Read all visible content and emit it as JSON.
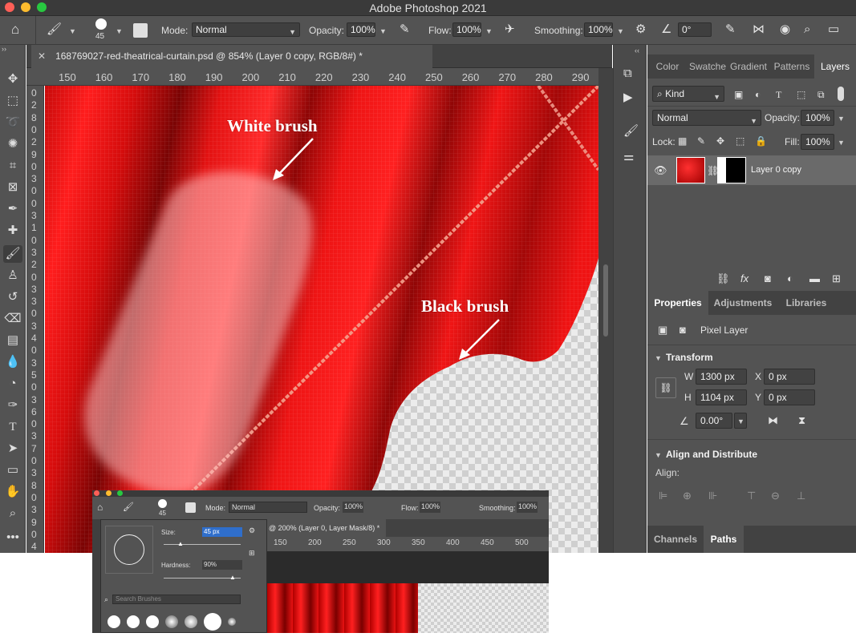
{
  "app": {
    "title": "Adobe Photoshop 2021"
  },
  "options_bar": {
    "brush_size": "45",
    "mode_label": "Mode:",
    "mode_value": "Normal",
    "opacity_label": "Opacity:",
    "opacity_value": "100%",
    "flow_label": "Flow:",
    "flow_value": "100%",
    "smoothing_label": "Smoothing:",
    "smoothing_value": "100%",
    "angle_value": "0°"
  },
  "document": {
    "tab_title": "168769027-red-theatrical-curtain.psd @ 854% (Layer 0 copy, RGB/8#) *",
    "ruler_h": [
      "150",
      "160",
      "170",
      "180",
      "190",
      "200",
      "210",
      "220",
      "230",
      "240",
      "250",
      "260",
      "270",
      "280",
      "290"
    ],
    "ruler_v": [
      "0",
      "2",
      "8",
      "0",
      "2",
      "9",
      "0",
      "3",
      "0",
      "0",
      "3",
      "1",
      "0",
      "3",
      "2",
      "0",
      "3",
      "3",
      "0",
      "3",
      "4",
      "0",
      "3",
      "5",
      "0",
      "3",
      "6",
      "0",
      "3",
      "7",
      "0",
      "3",
      "8",
      "0",
      "3",
      "9",
      "0",
      "4"
    ]
  },
  "annotations": {
    "white": "White brush",
    "black": "Black brush"
  },
  "layers_panel": {
    "tabs": [
      "Color",
      "Swatche",
      "Gradient",
      "Patterns",
      "Layers"
    ],
    "active_tab": "Layers",
    "filter_value": "Kind",
    "blend_mode": "Normal",
    "opacity_label": "Opacity:",
    "opacity_value": "100%",
    "lock_label": "Lock:",
    "fill_label": "Fill:",
    "fill_value": "100%",
    "layers": [
      {
        "name": "Layer 0 copy"
      }
    ]
  },
  "properties_panel": {
    "tabs": [
      "Properties",
      "Adjustments",
      "Libraries"
    ],
    "type_label": "Pixel Layer",
    "transform_header": "Transform",
    "w_label": "W",
    "w_value": "1300 px",
    "h_label": "H",
    "h_value": "1104 px",
    "x_label": "X",
    "x_value": "0 px",
    "y_label": "Y",
    "y_value": "0 px",
    "angle_value": "0.00°",
    "align_header": "Align and Distribute",
    "align_label": "Align:"
  },
  "bottom_tabs": [
    "Channels",
    "Paths"
  ],
  "inset": {
    "brush_size": "45",
    "mode_label": "Mode:",
    "mode_value": "Normal",
    "opacity_label": "Opacity:",
    "opacity_value": "100%",
    "flow_label": "Flow:",
    "flow_value": "100%",
    "smoothing_label": "Smoothing:",
    "smoothing_value": "100%",
    "size_label": "Size:",
    "size_value": "45 px",
    "hardness_label": "Hardness:",
    "hardness_value": "90%",
    "search_placeholder": "Search Brushes",
    "tab_title": "@ 200% (Layer 0, Layer Mask/8) *",
    "ruler": [
      "150",
      "200",
      "250",
      "300",
      "350",
      "400",
      "450",
      "500",
      "550"
    ]
  }
}
